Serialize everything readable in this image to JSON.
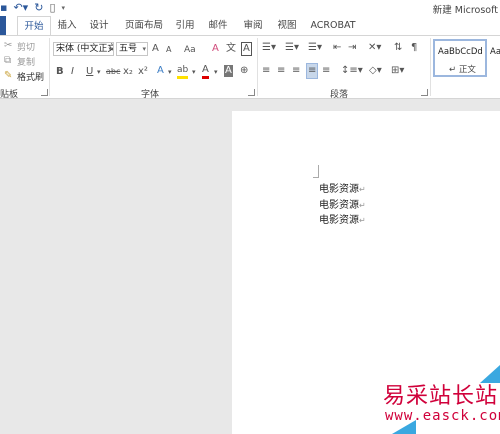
{
  "window": {
    "title": "新建 Microsoft"
  },
  "qat": {
    "icons": [
      "save-icon",
      "undo-icon",
      "redo-icon",
      "new-document-icon",
      "customize-icon"
    ]
  },
  "tabs": [
    "开始",
    "插入",
    "设计",
    "页面布局",
    "引用",
    "邮件",
    "审阅",
    "视图",
    "ACROBAT"
  ],
  "clipboard": {
    "cut": "剪切",
    "copy": "复制",
    "format_painter": "格式刷",
    "group": "贴板"
  },
  "font": {
    "name": "宋体 (中文正文",
    "size": "五号",
    "group": "字体",
    "buttons": {
      "bold": "B",
      "italic": "I",
      "underline": "U",
      "strike": "abc",
      "subscript": "x₂",
      "superscript": "x²",
      "grow": "A",
      "shrink": "A",
      "case": "Aa",
      "clear": "A",
      "phonetic": "文",
      "border": "A",
      "effects": "A",
      "highlight": "ab",
      "color": "A",
      "shade": "A",
      "enclose": "⊕"
    }
  },
  "paragraph": {
    "group": "段落"
  },
  "styles": {
    "normal_preview": "AaBbCcDd",
    "normal_label": "正文",
    "next_preview": "AaBb"
  },
  "document": {
    "lines": [
      "电影资源",
      "电影资源",
      "电影资源"
    ]
  },
  "watermark": {
    "title": "易采站长站",
    "url": "www.easck.com"
  },
  "colors": {
    "accent": "#2b579a",
    "watermark_red": "#d0003a",
    "watermark_blue": "#3aa8e0"
  }
}
